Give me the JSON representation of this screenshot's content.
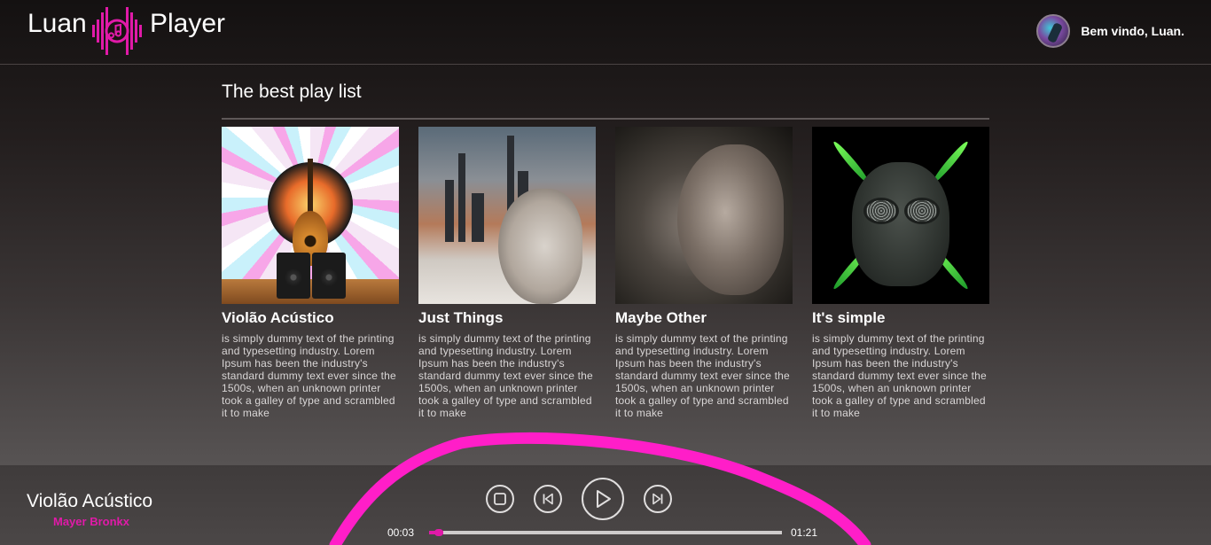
{
  "app": {
    "logo_left": "Luan",
    "logo_right": "Player",
    "welcome": "Bem vindo, Luan."
  },
  "playlist": {
    "title": "The best play list",
    "items": [
      {
        "title": "Violão Acústico",
        "description": "is simply dummy text of the printing and typesetting industry. Lorem Ipsum has been the industry's standard dummy text ever since the 1500s, when an unknown printer took a galley of type and scrambled it to make"
      },
      {
        "title": "Just Things",
        "description": "is simply dummy text of the printing and typesetting industry. Lorem Ipsum has been the industry's standard dummy text ever since the 1500s, when an unknown printer took a galley of type and scrambled it to make"
      },
      {
        "title": "Maybe Other",
        "description": "is simply dummy text of the printing and typesetting industry. Lorem Ipsum has been the industry's standard dummy text ever since the 1500s, when an unknown printer took a galley of type and scrambled it to make"
      },
      {
        "title": "It's simple",
        "description": "is simply dummy text of the printing and typesetting industry. Lorem Ipsum has been the industry's standard dummy text ever since the 1500s, when an unknown printer took a galley of type and scrambled it to make"
      }
    ]
  },
  "player": {
    "track_title": "Violão Acústico",
    "artist": "Mayer Bronkx",
    "current_time": "00:03",
    "duration": "01:21",
    "progress": 0.04,
    "controls": [
      "stop-icon",
      "previous-icon",
      "play-icon",
      "next-icon"
    ]
  },
  "colors": {
    "accent": "#e01aa8",
    "annotation": "#ff1ec8"
  }
}
